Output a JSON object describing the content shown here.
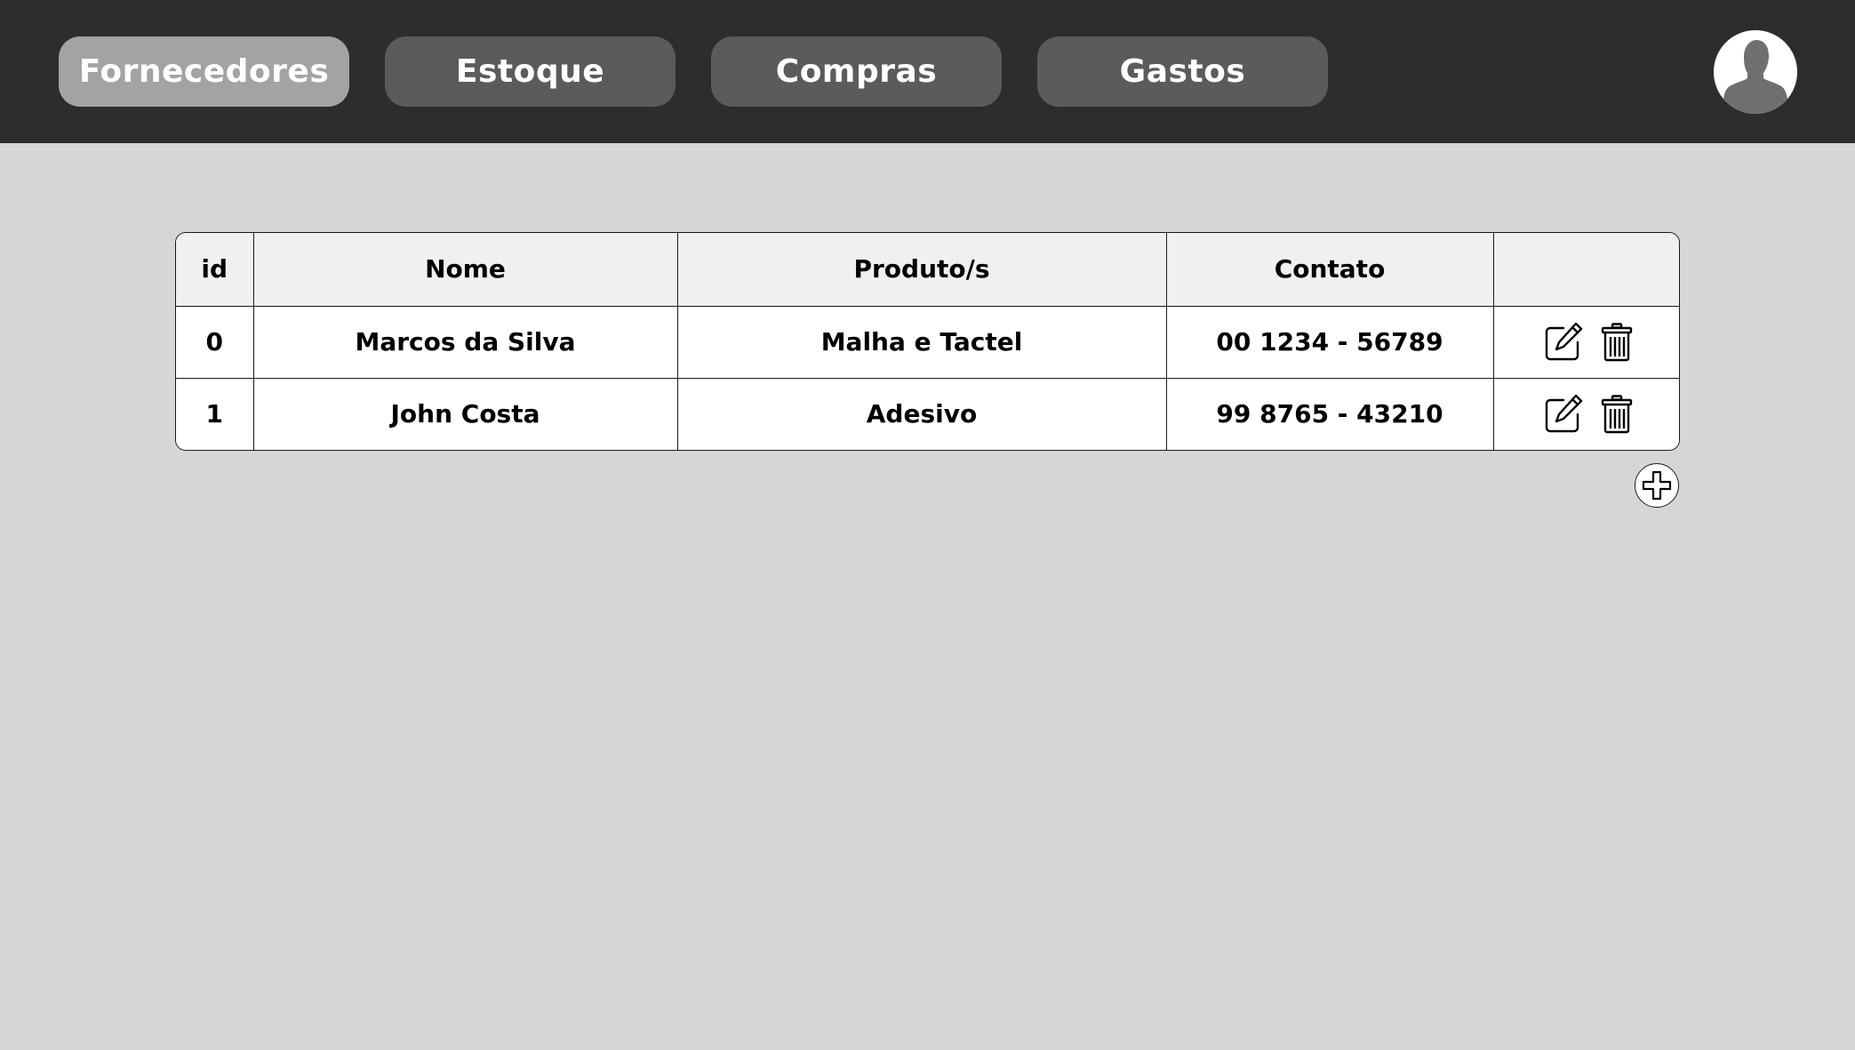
{
  "nav": {
    "tabs": [
      {
        "label": "Fornecedores",
        "active": true
      },
      {
        "label": "Estoque",
        "active": false
      },
      {
        "label": "Compras",
        "active": false
      },
      {
        "label": "Gastos",
        "active": false
      }
    ]
  },
  "table": {
    "headers": [
      "id",
      "Nome",
      "Produto/s",
      "Contato",
      ""
    ],
    "rows": [
      {
        "id": "0",
        "nome": "Marcos da Silva",
        "produtos": "Malha e Tactel",
        "contato": "00 1234 - 56789"
      },
      {
        "id": "1",
        "nome": "John Costa",
        "produtos": "Adesivo",
        "contato": "99 8765 - 43210"
      }
    ]
  },
  "icons": {
    "avatar": "user-silhouette-icon",
    "edit": "edit-icon",
    "delete": "trash-icon",
    "add": "plus-icon"
  },
  "colors": {
    "topbar": "#2d2d2d",
    "tab": "#5b5b5b",
    "tab_active": "#a3a3a3",
    "background": "#d6d6d6",
    "header_row": "#f0f0f0"
  }
}
